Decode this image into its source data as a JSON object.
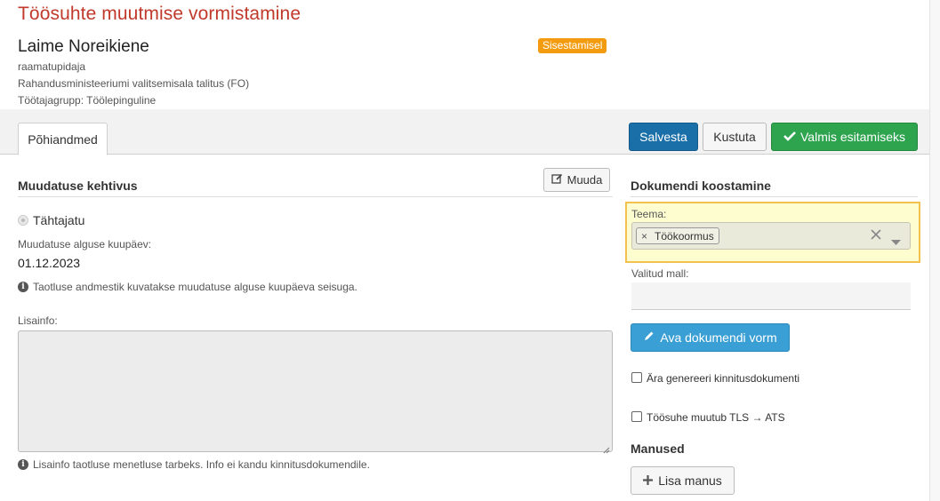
{
  "header": {
    "title": "Töösuhte muutmise vormistamine",
    "employee_name": "Laime Noreikiene",
    "position": "raamatupidaja",
    "department": "Rahandusministeeriumi valitsemisala talitus (FO)",
    "group": "Töötajagrupp: Töölepinguline",
    "status_badge": "Sisestamisel",
    "status_color": "#f39c12"
  },
  "tabs": [
    {
      "label": "Põhiandmed"
    }
  ],
  "toolbar": {
    "save_label": "Salvesta",
    "delete_label": "Kustuta",
    "ready_label": "Valmis esitamiseks"
  },
  "validity": {
    "section_title": "Muudatuse kehtivus",
    "edit_label": "Muuda",
    "radio_label": "Tähtajatu",
    "start_date_label": "Muudatuse alguse kuupäev:",
    "start_date_value": "01.12.2023",
    "info_note": "Taotluse andmestik kuvatakse muudatuse alguse kuupäeva seisuga."
  },
  "extra_info": {
    "label": "Lisainfo:",
    "value": "",
    "note": "Lisainfo taotluse menetluse tarbeks. Info ei kandu kinnitusdokumendile."
  },
  "document": {
    "section_title": "Dokumendi koostamine",
    "topic_label": "Teema:",
    "topic_tag": "Töökoormus",
    "tag_remove": "×",
    "template_label": "Valitud mall:",
    "template_value": "",
    "open_form_label": "Ava dokumendi vorm",
    "no_confirmation_label": "Ära genereeri kinnitusdokumenti",
    "no_confirmation_checked": false,
    "tls_ats_label": "Töösuhe muutub TLS → ATS",
    "tls_ats_checked": false
  },
  "attachments": {
    "title": "Manused",
    "add_label": "Lisa manus"
  },
  "colors": {
    "title_red": "#c0392b",
    "primary": "#1b6fa8",
    "success": "#2ea44f",
    "info": "#3a9fd4",
    "highlight_border": "#f2c150"
  }
}
